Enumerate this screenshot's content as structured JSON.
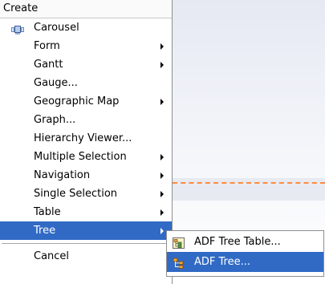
{
  "menu": {
    "header": "Create",
    "items": [
      {
        "label": "Carousel",
        "icon": "carousel-icon"
      },
      {
        "label": "Form",
        "submenu": true
      },
      {
        "label": "Gantt",
        "submenu": true
      },
      {
        "label": "Gauge..."
      },
      {
        "label": "Geographic Map",
        "submenu": true
      },
      {
        "label": "Graph..."
      },
      {
        "label": "Hierarchy Viewer..."
      },
      {
        "label": "Multiple Selection",
        "submenu": true
      },
      {
        "label": "Navigation",
        "submenu": true
      },
      {
        "label": "Single Selection",
        "submenu": true
      },
      {
        "label": "Table",
        "submenu": true
      },
      {
        "label": "Tree",
        "submenu": true,
        "selected": true
      }
    ],
    "cancel_label": "Cancel"
  },
  "submenu": {
    "items": [
      {
        "label": "ADF Tree Table...",
        "icon": "tree-table-icon"
      },
      {
        "label": "ADF Tree...",
        "icon": "tree-icon",
        "selected": true
      }
    ]
  },
  "colors": {
    "selection": "#316ac5",
    "dashed_line": "#ff8a3d"
  }
}
